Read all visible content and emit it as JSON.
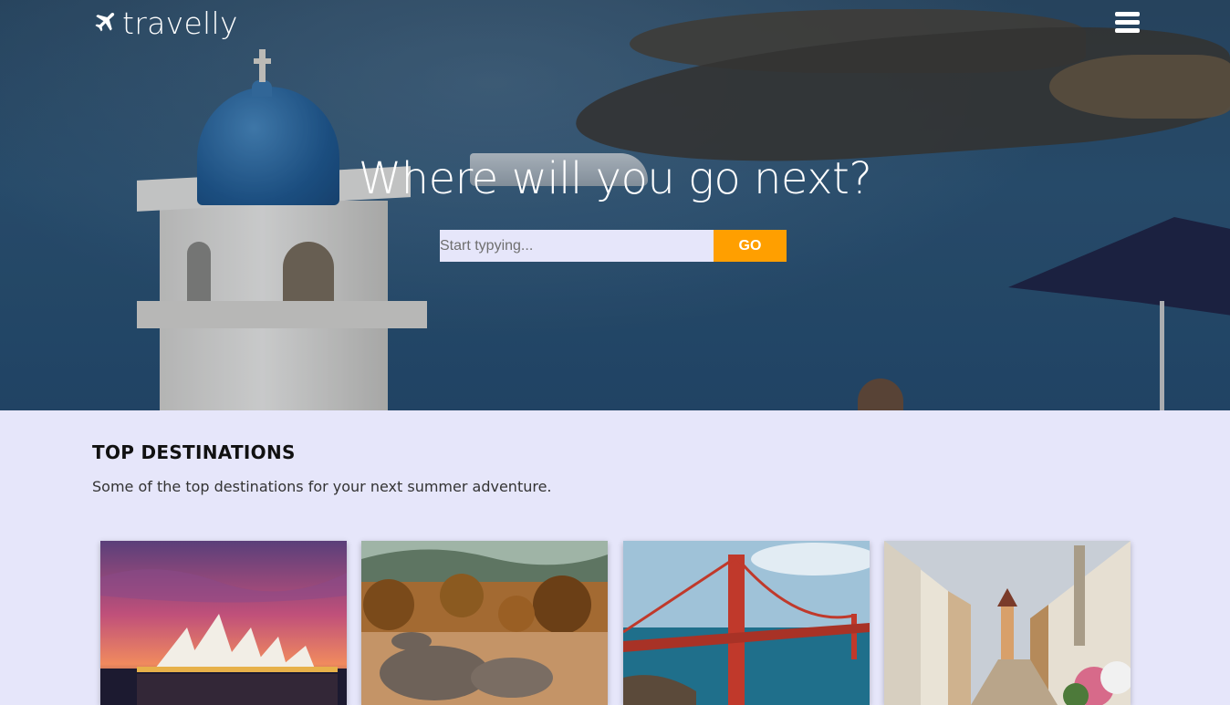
{
  "brand": {
    "name": "travelly"
  },
  "hero": {
    "title": "Where will you go next?",
    "search_placeholder": "Start typying...",
    "search_button": "GO"
  },
  "top_destinations": {
    "heading": "TOP DESTINATIONS",
    "subtitle": "Some of the top destinations for your next summer adventure.",
    "cards": [
      {
        "image": "sydney-opera-house"
      },
      {
        "image": "rhinos-savanna"
      },
      {
        "image": "golden-gate-bridge"
      },
      {
        "image": "old-town-street"
      }
    ]
  },
  "colors": {
    "accent": "#ff9f00",
    "background": "#e6e6fa"
  },
  "icons": {
    "logo": "airplane-icon",
    "menu": "hamburger-menu-icon"
  }
}
